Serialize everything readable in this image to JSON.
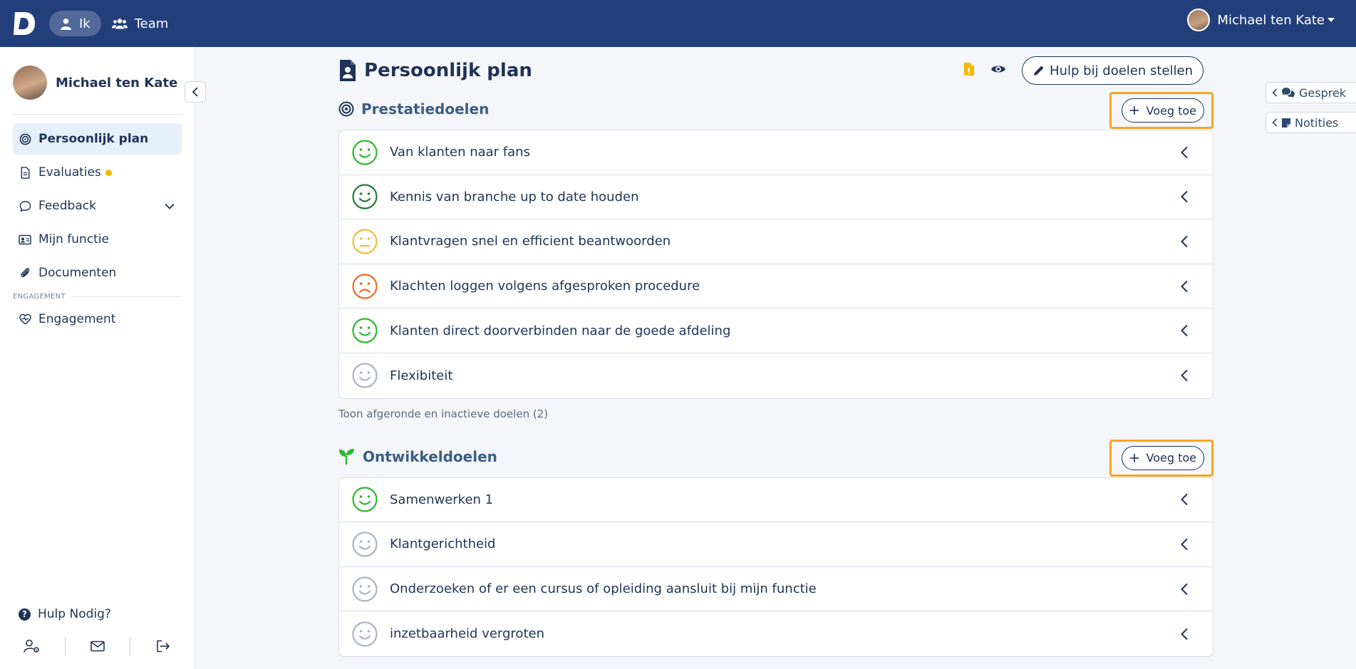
{
  "topbar": {
    "nav": [
      {
        "label": "Ik",
        "icon": "user-icon",
        "active": true
      },
      {
        "label": "Team",
        "icon": "users-icon",
        "active": false
      }
    ],
    "user_name": "Michael ten Kate"
  },
  "sidebar": {
    "profile_name": "Michael ten Kate",
    "items": [
      {
        "label": "Persoonlijk plan",
        "icon": "target-icon",
        "active": true
      },
      {
        "label": "Evaluaties",
        "icon": "document-icon",
        "badge_dot": true
      },
      {
        "label": "Feedback",
        "icon": "chat-icon",
        "expandable": true
      },
      {
        "label": "Mijn functie",
        "icon": "id-card-icon"
      },
      {
        "label": "Documenten",
        "icon": "paperclip-icon"
      }
    ],
    "section_label": "ENGAGEMENT",
    "section_items": [
      {
        "label": "Engagement",
        "icon": "heart-pulse-icon"
      }
    ],
    "help_label": "Hulp Nodig?",
    "bottom_icons": [
      "user-settings-icon",
      "mail-icon",
      "logout-icon"
    ]
  },
  "main": {
    "page_title": "Persoonlijk plan",
    "help_button": "Hulp bij doelen stellen",
    "sections": [
      {
        "title": "Prestatiedoelen",
        "icon": "target-icon",
        "add_label": "Voeg toe",
        "goals": [
          {
            "text": "Van klanten naar fans",
            "mood": "happy",
            "color": "#2db82d"
          },
          {
            "text": "Kennis van branche up to date houden",
            "mood": "happy",
            "color": "#1e7d32"
          },
          {
            "text": "Klantvragen snel en efficient beantwoorden",
            "mood": "neutral",
            "color": "#f5b942"
          },
          {
            "text": "Klachten loggen volgens afgesproken procedure",
            "mood": "sad",
            "color": "#ee6a2a"
          },
          {
            "text": "Klanten direct doorverbinden naar de goede afdeling",
            "mood": "happy",
            "color": "#2db82d"
          },
          {
            "text": "Flexibiteit",
            "mood": "happy",
            "color": "#aab4c3"
          }
        ],
        "show_more": "Toon afgeronde en inactieve doelen (2)"
      },
      {
        "title": "Ontwikkeldoelen",
        "icon": "sprout-icon",
        "add_label": "Voeg toe",
        "goals": [
          {
            "text": "Samenwerken 1",
            "mood": "happy",
            "color": "#2db82d"
          },
          {
            "text": "Klantgerichtheid",
            "mood": "happy",
            "color": "#aab4c3"
          },
          {
            "text": "Onderzoeken of er een cursus of opleiding aansluit bij mijn functie",
            "mood": "happy",
            "color": "#aab4c3"
          },
          {
            "text": "inzetbaarheid vergroten",
            "mood": "happy",
            "color": "#aab4c3"
          }
        ]
      }
    ]
  },
  "side_tabs": [
    {
      "label": "Gesprek",
      "icon": "chat-bubbles-icon"
    },
    {
      "label": "Notities",
      "icon": "note-icon"
    }
  ],
  "colors": {
    "topbar": "#233f7b",
    "text": "#1f3357",
    "highlight_border": "#f5a623"
  }
}
